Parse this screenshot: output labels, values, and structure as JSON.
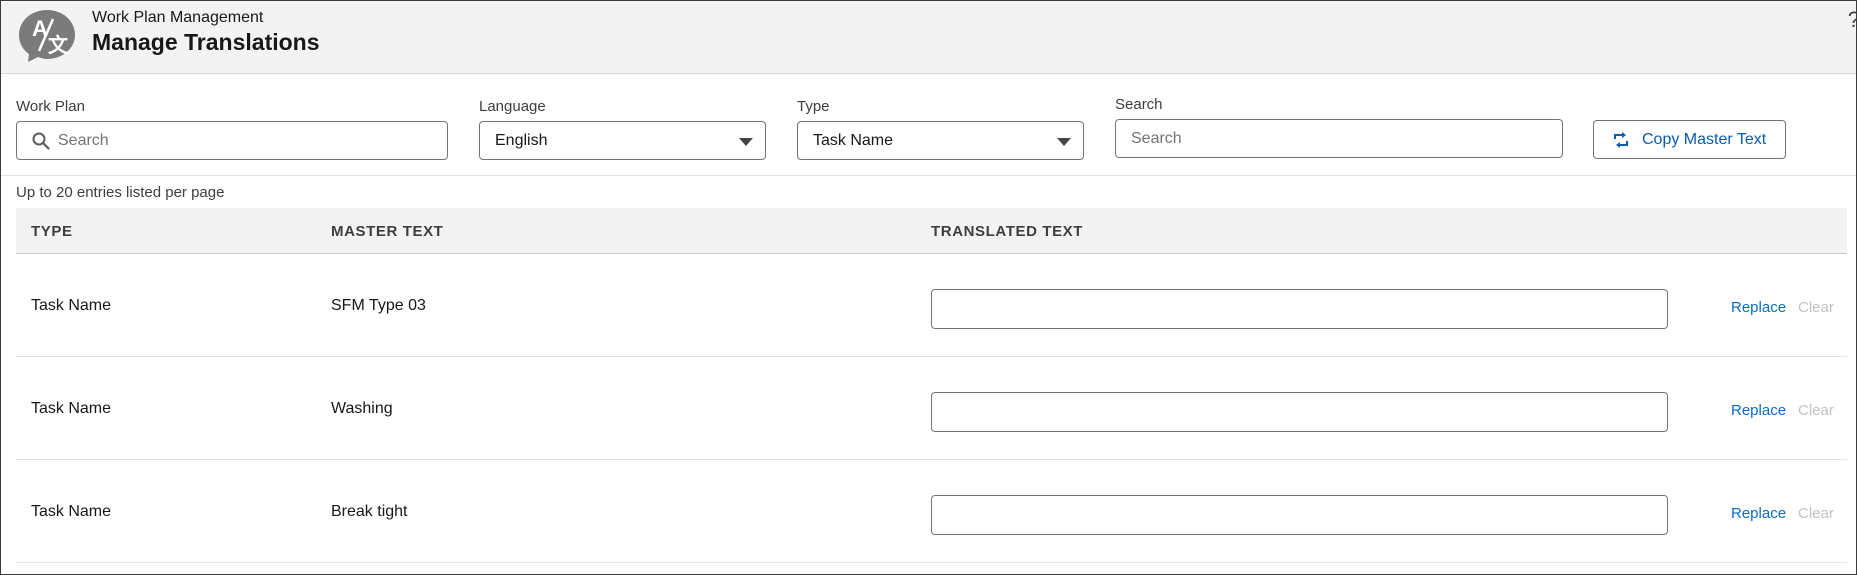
{
  "header": {
    "subtitle": "Work Plan Management",
    "title": "Manage Translations",
    "app_icon": "translate-icon",
    "help_icon": "help-icon",
    "help_glyph": "?"
  },
  "filters": {
    "work_plan": {
      "label": "Work Plan",
      "placeholder": "Search",
      "icon": "search-icon"
    },
    "language": {
      "label": "Language",
      "value": "English"
    },
    "type": {
      "label": "Type",
      "value": "Task Name"
    },
    "search": {
      "label": "Search",
      "placeholder": "Search"
    },
    "copy_button": {
      "label": "Copy Master Text",
      "icon": "copy-icon"
    }
  },
  "hint": "Up to 20 entries listed per page",
  "table": {
    "columns": [
      "TYPE",
      "MASTER TEXT",
      "TRANSLATED TEXT"
    ],
    "rows": [
      {
        "type": "Task Name",
        "master_text": "SFM Type 03",
        "translated_text": "",
        "replace": "Replace",
        "clear": "Clear"
      },
      {
        "type": "Task Name",
        "master_text": "Washing",
        "translated_text": "",
        "replace": "Replace",
        "clear": "Clear"
      },
      {
        "type": "Task Name",
        "master_text": "Break tight",
        "translated_text": "",
        "replace": "Replace",
        "clear": "Clear"
      }
    ]
  },
  "colors": {
    "brand_link": "#0b6bcb",
    "header_bg": "#f3f3f3",
    "icon_gray": "#7b7b7b",
    "disabled": "#c2c2c2"
  }
}
